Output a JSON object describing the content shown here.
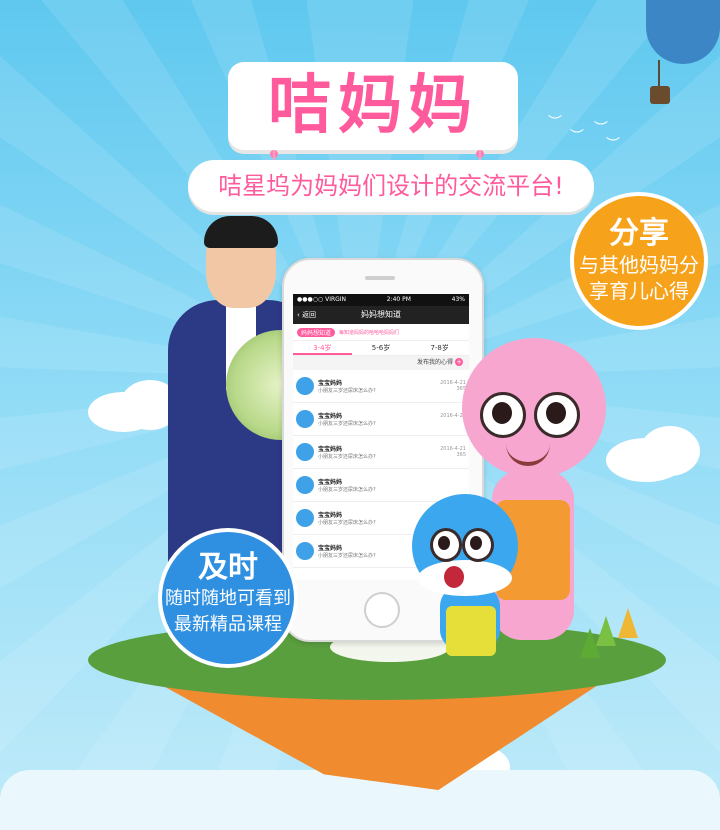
{
  "title": "咭妈妈",
  "subtitle": "咭星坞为妈妈们设计的交流平台!",
  "badge_share": {
    "heading": "分享",
    "line1": "与其他妈妈分",
    "line2": "享育儿心得"
  },
  "badge_timely": {
    "heading": "及时",
    "line1": "随时随地可看到",
    "line2": "最新精品课程"
  },
  "colors": {
    "brand_pink": "#ff5a9c",
    "badge_orange": "#f7a21b",
    "badge_blue": "#2f8fe0"
  },
  "phone": {
    "status": {
      "carrier": "●●●○○ VIRGIN",
      "time": "2:40 PM",
      "battery": "43%"
    },
    "nav": {
      "back": "返回",
      "title": "妈妈想知道"
    },
    "banner": {
      "pill": "妈妈想知道",
      "desc": "每知道妈妈的哈哈哈妈妈们"
    },
    "tabs": [
      "3-4岁",
      "5-6岁",
      "7-8岁"
    ],
    "post_label": "发布我的心得",
    "items": [
      {
        "name": "宝宝妈妈",
        "question": "小朋友三岁还尿床怎么办?",
        "date": "2016-4-21",
        "likes": "365"
      },
      {
        "name": "宝宝妈妈",
        "question": "小朋友三岁还尿床怎么办?",
        "date": "2016-4-21",
        "likes": "7"
      },
      {
        "name": "宝宝妈妈",
        "question": "小朋友三岁还尿床怎么办?",
        "date": "2016-4-21",
        "likes": "365"
      },
      {
        "name": "宝宝妈妈",
        "question": "小朋友三岁还尿床怎么办?",
        "date": "",
        "likes": ""
      },
      {
        "name": "宝宝妈妈",
        "question": "小朋友三岁还尿床怎么办?",
        "date": "",
        "likes": ""
      },
      {
        "name": "宝宝妈妈",
        "question": "小朋友三岁还尿床怎么办?",
        "date": "",
        "likes": ""
      }
    ]
  }
}
